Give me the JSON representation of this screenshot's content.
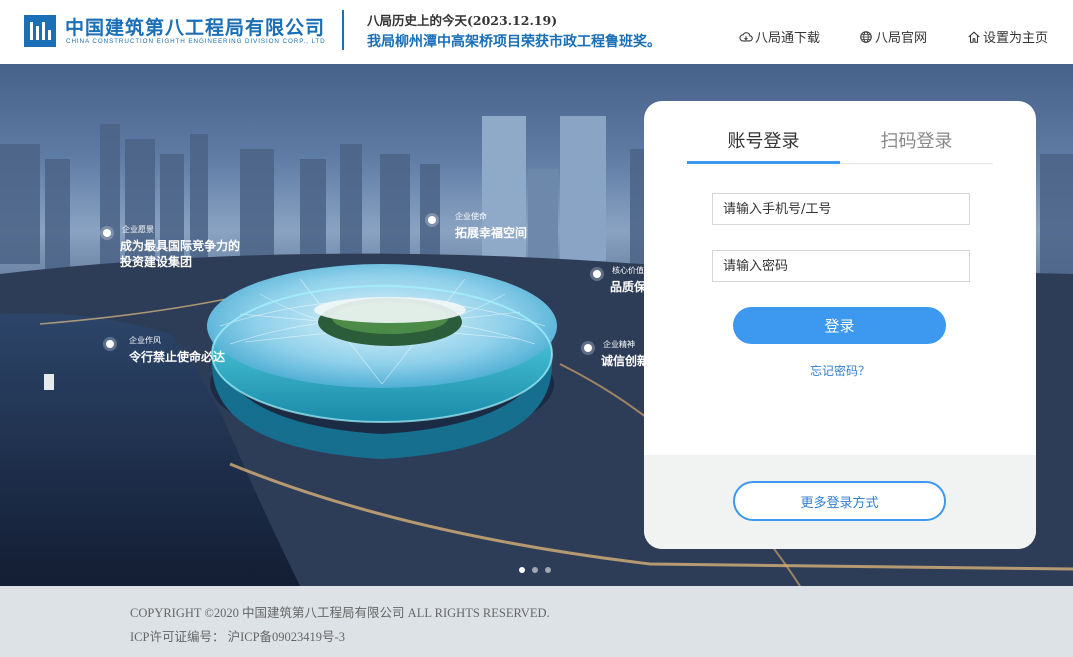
{
  "header": {
    "logo_cn": "中国建筑第八工程局有限公司",
    "logo_en": "CHINA CONSTRUCTION EIGHTH ENGINEERING DIVISION CORP., LTD",
    "history_title": "八局历史上的今天(2023.12.19)",
    "history_news": "我局柳州潭中高架桥项目荣获市政工程鲁班奖。",
    "links": [
      {
        "label": "八局通下载",
        "icon": "cloud-icon"
      },
      {
        "label": "八局官网",
        "icon": "globe-icon"
      },
      {
        "label": "设置为主页",
        "icon": "home-icon"
      }
    ]
  },
  "banner": {
    "callouts": [
      {
        "small": "企业愿景",
        "big_line1": "成为最具国际竞争力的",
        "big_line2": "投资建设集团"
      },
      {
        "small": "企业使命",
        "big_line1": "拓展幸福空间",
        "big_line2": ""
      },
      {
        "small": "核心价值",
        "big_line1": "品质保",
        "big_line2": ""
      },
      {
        "small": "企业作风",
        "big_line1": "令行禁止使命必达",
        "big_line2": ""
      },
      {
        "small": "企业精神",
        "big_line1": "诚信创新",
        "big_line2": ""
      }
    ],
    "carousel_count": 3,
    "carousel_active": 1
  },
  "login": {
    "tabs": [
      {
        "label": "账号登录",
        "active": true
      },
      {
        "label": "扫码登录",
        "active": false
      }
    ],
    "username_placeholder": "请输入手机号/工号",
    "password_placeholder": "请输入密码",
    "login_button": "登录",
    "forgot_link": "忘记密码？",
    "more_button": "更多登录方式"
  },
  "footer": {
    "copyright": "COPYRIGHT ©2020 中国建筑第八工程局有限公司 ALL RIGHTS RESERVED.",
    "icp": "ICP许可证编号： 沪ICP备09023419号-3"
  },
  "colors": {
    "brand_blue": "#1a6fb6",
    "accent": "#3d98f0",
    "footer_bg": "#dde2e6"
  }
}
